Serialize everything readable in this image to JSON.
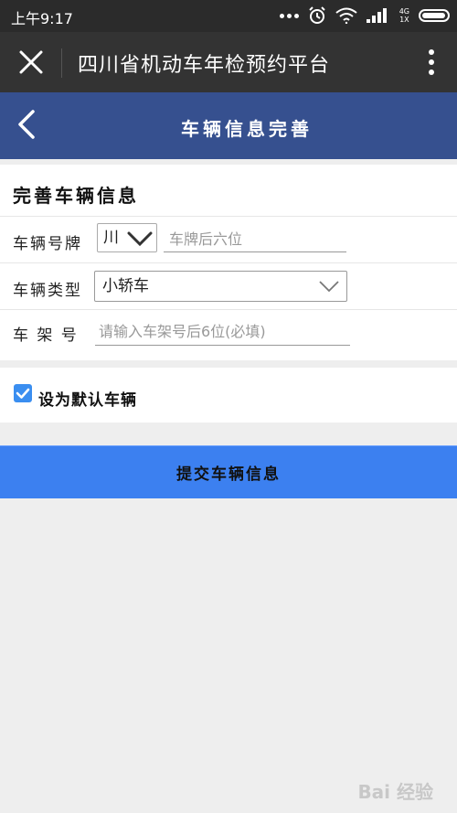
{
  "status_bar": {
    "time": "上午9:17",
    "network_top": "4G",
    "network_bottom": "1X"
  },
  "title_bar": {
    "title": "四川省机动车年检预约平台"
  },
  "header": {
    "title": "车辆信息完善"
  },
  "form": {
    "section_title": "完善车辆信息",
    "plate_label": "车辆号牌",
    "province_value": "川",
    "plate_placeholder": "车牌后六位",
    "type_label": "车辆类型",
    "type_value": "小轿车",
    "frame_label": "车 架 号",
    "frame_placeholder": "请输入车架号后6位(必填)"
  },
  "default_vehicle": {
    "label": "设为默认车辆",
    "checked": true
  },
  "submit": {
    "label": "提交车辆信息"
  },
  "watermark": {
    "text": "Bai 经验"
  },
  "colors": {
    "accent_header": "#36508f",
    "submit_button": "#3c80f0",
    "checkbox": "#3a8ef0"
  }
}
